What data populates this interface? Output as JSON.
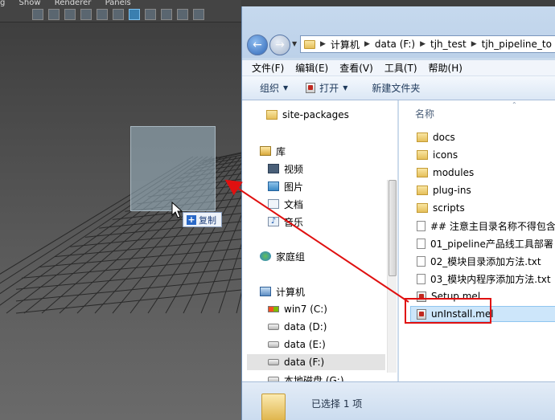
{
  "maya": {
    "menu": [
      "g",
      "Show",
      "Renderer",
      "Panels"
    ],
    "copy_badge_label": "复制"
  },
  "explorer": {
    "breadcrumb": [
      "计算机",
      "data (F:)",
      "tjh_test",
      "tjh_pipeline_to"
    ],
    "menu": [
      "文件(F)",
      "编辑(E)",
      "查看(V)",
      "工具(T)",
      "帮助(H)"
    ],
    "commands": {
      "organize": "组织",
      "open": "打开",
      "new_folder": "新建文件夹"
    },
    "nav_items": [
      {
        "label": "site-packages",
        "icon": "folder-icon"
      },
      {
        "label": "库",
        "icon": "library-icon"
      },
      {
        "label": "视频",
        "icon": "video-icon"
      },
      {
        "label": "图片",
        "icon": "picture-icon"
      },
      {
        "label": "文档",
        "icon": "document-icon"
      },
      {
        "label": "音乐",
        "icon": "music-icon"
      },
      {
        "label": "家庭组",
        "icon": "homegroup-icon"
      },
      {
        "label": "计算机",
        "icon": "computer-icon"
      },
      {
        "label": "win7 (C:)",
        "icon": "windows-drive-icon"
      },
      {
        "label": "data (D:)",
        "icon": "drive-icon"
      },
      {
        "label": "data (E:)",
        "icon": "drive-icon"
      },
      {
        "label": "data (F:)",
        "icon": "drive-icon"
      },
      {
        "label": "本地磁盘 (G:)",
        "icon": "drive-icon"
      }
    ],
    "column_header": "名称",
    "files": [
      {
        "label": "docs",
        "icon": "folder-icon"
      },
      {
        "label": "icons",
        "icon": "folder-icon"
      },
      {
        "label": "modules",
        "icon": "folder-icon"
      },
      {
        "label": "plug-ins",
        "icon": "folder-icon"
      },
      {
        "label": "scripts",
        "icon": "folder-icon"
      },
      {
        "label": "## 注意主目录名称不得包含",
        "icon": "text-file-icon"
      },
      {
        "label": "01_pipeline产品线工具部署",
        "icon": "text-file-icon"
      },
      {
        "label": "02_模块目录添加方法.txt",
        "icon": "text-file-icon"
      },
      {
        "label": "03_模块内程序添加方法.txt",
        "icon": "text-file-icon"
      },
      {
        "label": "Setup.mel",
        "icon": "mel-file-icon"
      },
      {
        "label": "unInstall.mel",
        "icon": "mel-file-icon"
      }
    ],
    "status_text": "已选择 1 项"
  }
}
